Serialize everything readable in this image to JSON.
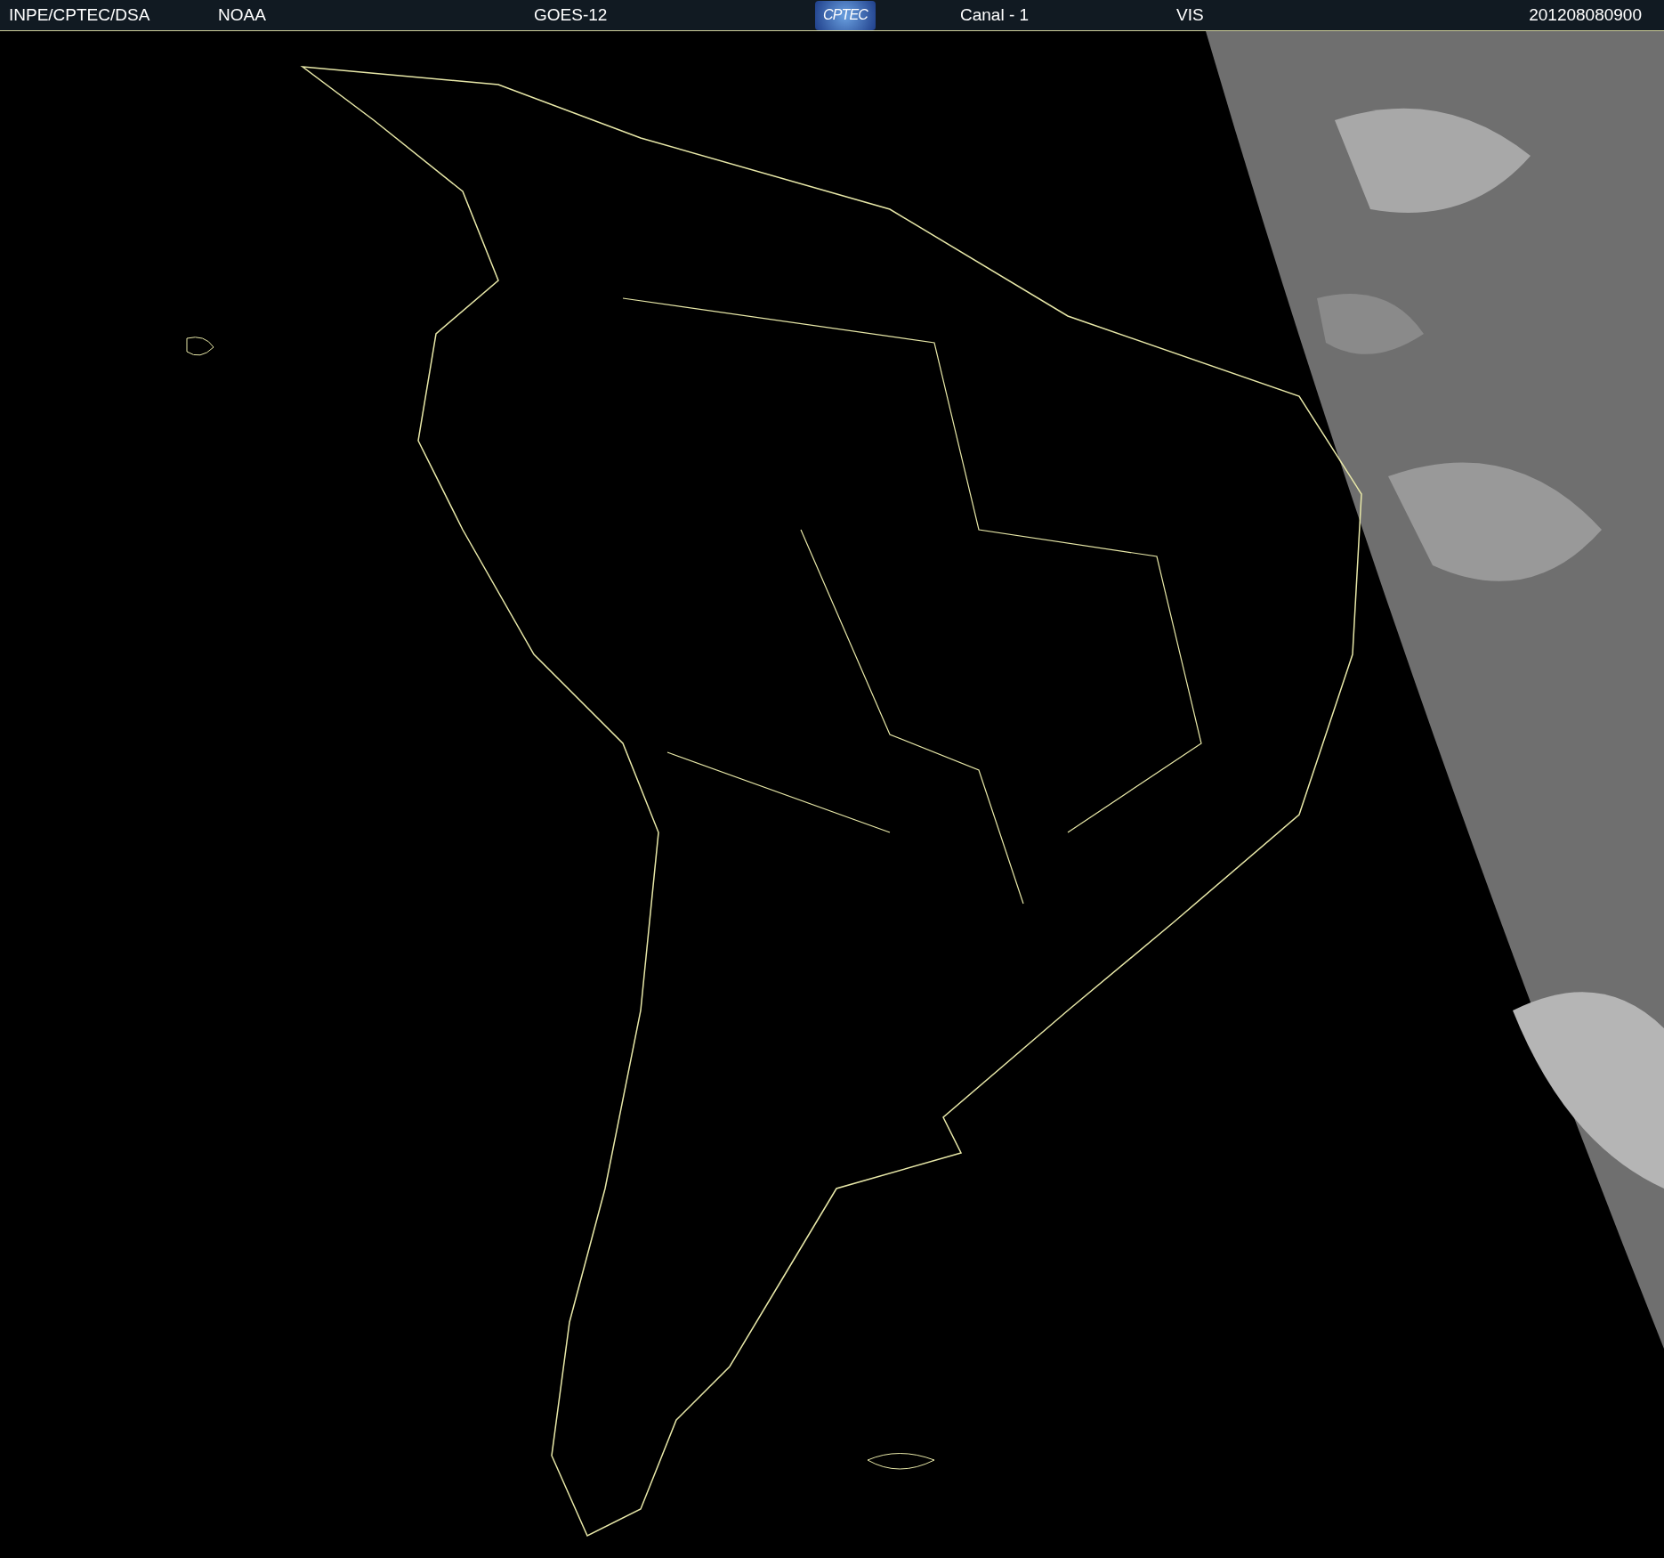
{
  "header": {
    "agency": "INPE/CPTEC/DSA",
    "source": "NOAA",
    "satellite": "GOES-12",
    "logo": "CPTEC",
    "channel": "Canal - 1",
    "band": "VIS",
    "timestamp": "201208080900"
  }
}
